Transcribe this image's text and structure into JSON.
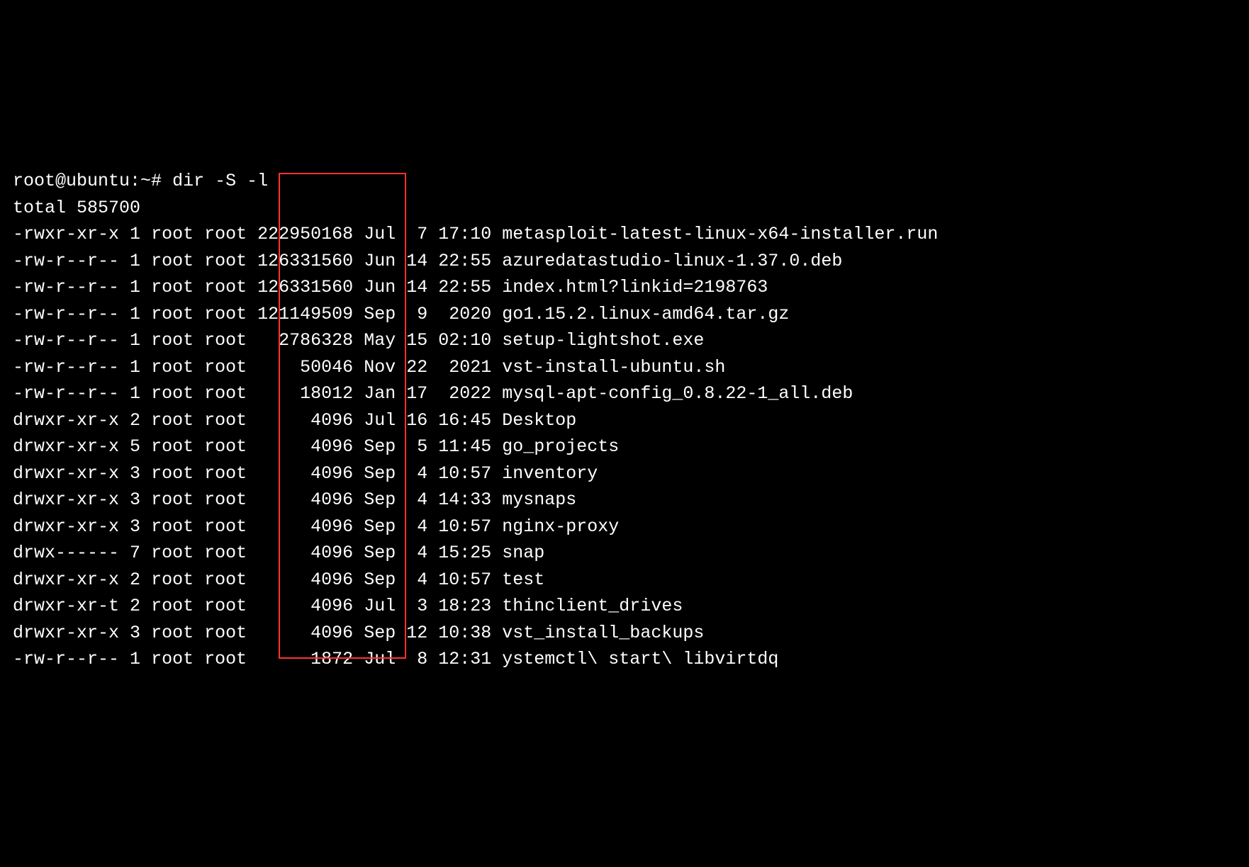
{
  "prompt": "root@ubuntu:~#",
  "command": "dir -S -l",
  "total_label": "total",
  "total_value": "585700",
  "highlight_color": "#ff3333",
  "entries": [
    {
      "perms": "-rwxr-xr-x",
      "links": "1",
      "owner": "root",
      "group": "root",
      "size": "222950168",
      "month": "Jul",
      "day": "7",
      "time": "17:10",
      "name": "metasploit-latest-linux-x64-installer.run"
    },
    {
      "perms": "-rw-r--r--",
      "links": "1",
      "owner": "root",
      "group": "root",
      "size": "126331560",
      "month": "Jun",
      "day": "14",
      "time": "22:55",
      "name": "azuredatastudio-linux-1.37.0.deb"
    },
    {
      "perms": "-rw-r--r--",
      "links": "1",
      "owner": "root",
      "group": "root",
      "size": "126331560",
      "month": "Jun",
      "day": "14",
      "time": "22:55",
      "name": "index.html?linkid=2198763"
    },
    {
      "perms": "-rw-r--r--",
      "links": "1",
      "owner": "root",
      "group": "root",
      "size": "121149509",
      "month": "Sep",
      "day": "9",
      "time": "2020",
      "name": "go1.15.2.linux-amd64.tar.gz"
    },
    {
      "perms": "-rw-r--r--",
      "links": "1",
      "owner": "root",
      "group": "root",
      "size": "2786328",
      "month": "May",
      "day": "15",
      "time": "02:10",
      "name": "setup-lightshot.exe"
    },
    {
      "perms": "-rw-r--r--",
      "links": "1",
      "owner": "root",
      "group": "root",
      "size": "50046",
      "month": "Nov",
      "day": "22",
      "time": "2021",
      "name": "vst-install-ubuntu.sh"
    },
    {
      "perms": "-rw-r--r--",
      "links": "1",
      "owner": "root",
      "group": "root",
      "size": "18012",
      "month": "Jan",
      "day": "17",
      "time": "2022",
      "name": "mysql-apt-config_0.8.22-1_all.deb"
    },
    {
      "perms": "drwxr-xr-x",
      "links": "2",
      "owner": "root",
      "group": "root",
      "size": "4096",
      "month": "Jul",
      "day": "16",
      "time": "16:45",
      "name": "Desktop"
    },
    {
      "perms": "drwxr-xr-x",
      "links": "5",
      "owner": "root",
      "group": "root",
      "size": "4096",
      "month": "Sep",
      "day": "5",
      "time": "11:45",
      "name": "go_projects"
    },
    {
      "perms": "drwxr-xr-x",
      "links": "3",
      "owner": "root",
      "group": "root",
      "size": "4096",
      "month": "Sep",
      "day": "4",
      "time": "10:57",
      "name": "inventory"
    },
    {
      "perms": "drwxr-xr-x",
      "links": "3",
      "owner": "root",
      "group": "root",
      "size": "4096",
      "month": "Sep",
      "day": "4",
      "time": "14:33",
      "name": "mysnaps"
    },
    {
      "perms": "drwxr-xr-x",
      "links": "3",
      "owner": "root",
      "group": "root",
      "size": "4096",
      "month": "Sep",
      "day": "4",
      "time": "10:57",
      "name": "nginx-proxy"
    },
    {
      "perms": "drwx------",
      "links": "7",
      "owner": "root",
      "group": "root",
      "size": "4096",
      "month": "Sep",
      "day": "4",
      "time": "15:25",
      "name": "snap"
    },
    {
      "perms": "drwxr-xr-x",
      "links": "2",
      "owner": "root",
      "group": "root",
      "size": "4096",
      "month": "Sep",
      "day": "4",
      "time": "10:57",
      "name": "test"
    },
    {
      "perms": "drwxr-xr-t",
      "links": "2",
      "owner": "root",
      "group": "root",
      "size": "4096",
      "month": "Jul",
      "day": "3",
      "time": "18:23",
      "name": "thinclient_drives"
    },
    {
      "perms": "drwxr-xr-x",
      "links": "3",
      "owner": "root",
      "group": "root",
      "size": "4096",
      "month": "Sep",
      "day": "12",
      "time": "10:38",
      "name": "vst_install_backups"
    },
    {
      "perms": "-rw-r--r--",
      "links": "1",
      "owner": "root",
      "group": "root",
      "size": "1872",
      "month": "Jul",
      "day": "8",
      "time": "12:31",
      "name": "ystemctl\\ start\\ libvirtdq"
    }
  ]
}
